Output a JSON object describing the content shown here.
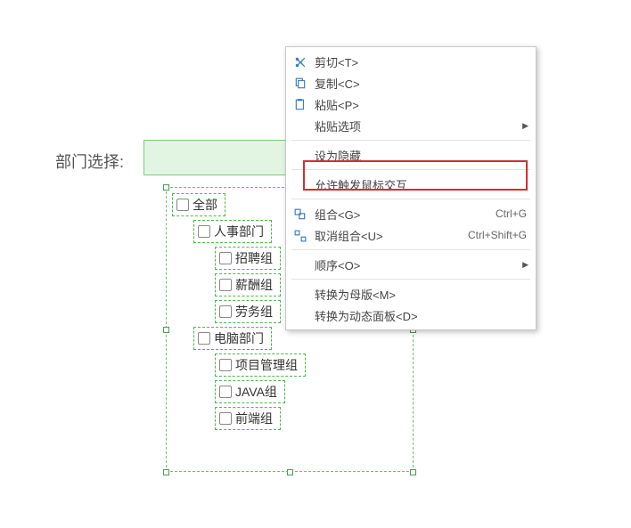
{
  "label": "部门选择:",
  "tree": {
    "items": [
      {
        "level": 0,
        "label": "全部"
      },
      {
        "level": 1,
        "label": "人事部门"
      },
      {
        "level": 2,
        "label": "招聘组"
      },
      {
        "level": 2,
        "label": "薪酬组"
      },
      {
        "level": 2,
        "label": "劳务组"
      },
      {
        "level": 1,
        "label": "电脑部门"
      },
      {
        "level": 2,
        "label": "项目管理组"
      },
      {
        "level": 2,
        "label": "JAVA组"
      },
      {
        "level": 2,
        "label": "前端组"
      }
    ]
  },
  "menu": {
    "cut": "剪切<T>",
    "copy": "复制<C>",
    "paste": "粘贴<P>",
    "paste_opt": "粘贴选项",
    "set_hidden": "设为隐藏",
    "allow_mouse": "允许触发鼠标交互",
    "group": "组合<G>",
    "group_key": "Ctrl+G",
    "ungroup": "取消组合<U>",
    "ungroup_key": "Ctrl+Shift+G",
    "order": "顺序<O>",
    "to_master": "转换为母版<M>",
    "to_dynamic": "转换为动态面板<D>"
  }
}
